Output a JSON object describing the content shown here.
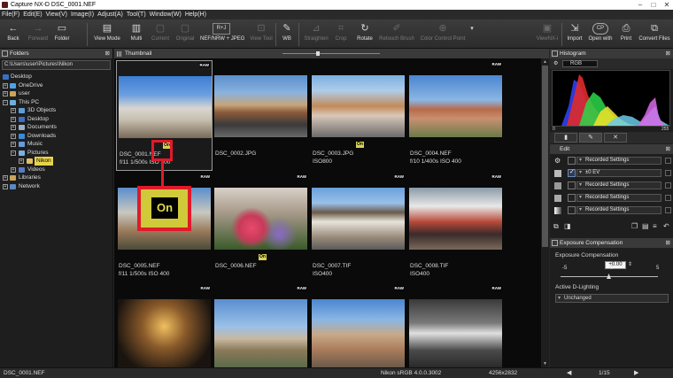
{
  "window": {
    "title": "Capture NX-D     DSC_0001.NEF"
  },
  "menu": [
    "File(F)",
    "Edit(E)",
    "View(V)",
    "Image(I)",
    "Adjust(A)",
    "Tool(T)",
    "Window(W)",
    "Help(H)"
  ],
  "toolbar": {
    "back": "Back",
    "forward": "Forward",
    "folder": "Folder",
    "view_mode": "View Mode",
    "multi": "Multi",
    "current": "Current",
    "original": "Original",
    "nrw_jpeg": "NEF/NRW + JPEG",
    "view_tool": "View Tool",
    "wb": "WB",
    "straighten": "Straighten",
    "crop": "Crop",
    "rotate": "Rotate",
    "retouch_brush": "Retouch Brush",
    "color_control_point": "Color Control Point",
    "viewnx_i": "ViewNX-i",
    "import": "Import",
    "open_with": "Open with",
    "print": "Print",
    "convert_files": "Convert Files",
    "cp_badge": "CP"
  },
  "folders": {
    "title": "Folders",
    "path": "C:\\Users\\user\\Pictures\\Nikon",
    "tree": {
      "desktop": "Desktop",
      "onedrive": "OneDrive",
      "user": "user",
      "this_pc": "This PC",
      "objects3d": "3D Objects",
      "desktop2": "Desktop",
      "documents": "Documents",
      "downloads": "Downloads",
      "music": "Music",
      "pictures": "Pictures",
      "nikon": "Nikon",
      "videos": "Videos",
      "libraries": "Libraries",
      "network": "Network"
    }
  },
  "thumbnail": {
    "title": "Thumbnail",
    "raw_badge": "RAW",
    "key_badge": "On",
    "items": [
      {
        "name": "DSC_0001.NEF",
        "info": "f/11 1/500s ISO 200"
      },
      {
        "name": "DSC_0002.JPG",
        "info": ""
      },
      {
        "name": "DSC_0003.JPG",
        "info": "ISO800"
      },
      {
        "name": "DSC_0004.NEF",
        "info": "f/10 1/400s ISO 400"
      },
      {
        "name": "DSC_0005.NEF",
        "info": "f/11 1/500s ISO 400"
      },
      {
        "name": "DSC_0006.NEF",
        "info": ""
      },
      {
        "name": "DSC_0007.TIF",
        "info": "ISO400"
      },
      {
        "name": "DSC_0008.TIF",
        "info": "ISO400"
      }
    ]
  },
  "histogram": {
    "title": "Histogram",
    "channel": "RGB",
    "min": "0",
    "max": "255"
  },
  "edit": {
    "title": "Edit",
    "rows": [
      "Recorded Settings",
      "±0 EV",
      "Recorded Settings",
      "Recorded Settings",
      "Recorded Settings"
    ]
  },
  "exposure": {
    "title": "Exposure Compensation",
    "label": "Exposure Compensation",
    "value": "+0.00",
    "min": "-5",
    "mid": "0",
    "max": "5",
    "level": 0,
    "adl_label": "Active D-Lighting",
    "adl_value": "Unchanged"
  },
  "status": {
    "file": "DSC_0001.NEF",
    "profile": "Nikon sRGB 4.0.0.3002",
    "dimensions": "4256x2832",
    "page": "1/15"
  }
}
